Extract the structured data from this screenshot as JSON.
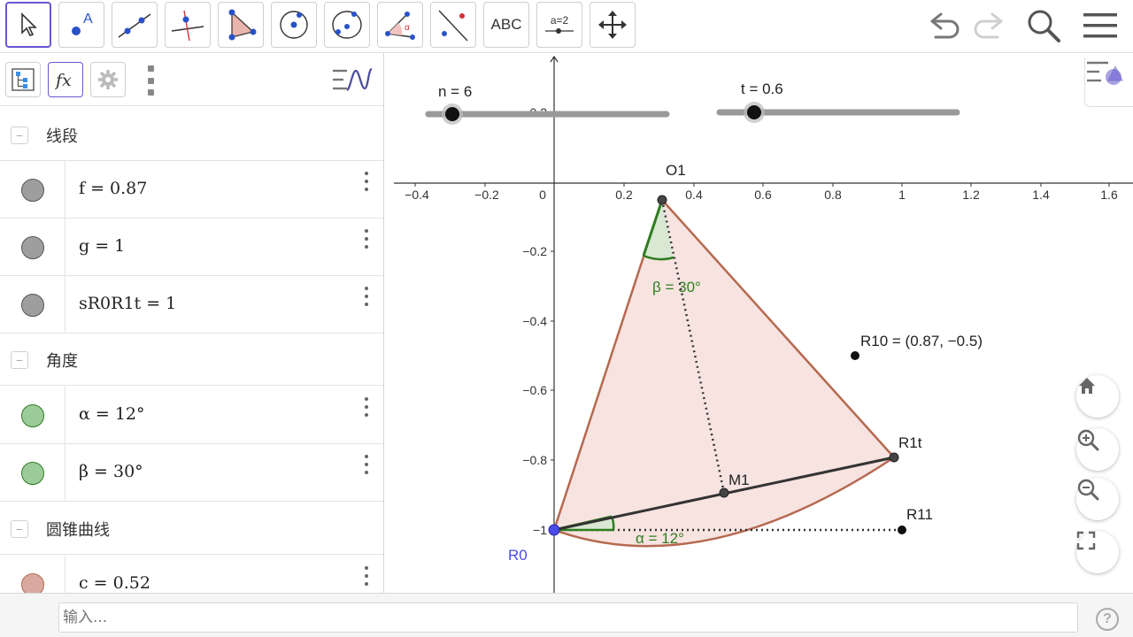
{
  "toolbar": {
    "tools": [
      {
        "id": "move",
        "icon": "arrow-cursor-icon"
      },
      {
        "id": "point",
        "icon": "point-icon"
      },
      {
        "id": "line",
        "icon": "line-icon"
      },
      {
        "id": "perpendicular",
        "icon": "perpendicular-line-icon"
      },
      {
        "id": "polygon",
        "icon": "polygon-icon"
      },
      {
        "id": "circle-center",
        "icon": "circle-center-icon"
      },
      {
        "id": "circle-3-points",
        "icon": "circle-three-points-icon"
      },
      {
        "id": "angle",
        "icon": "angle-icon"
      },
      {
        "id": "reflect",
        "icon": "reflect-icon"
      },
      {
        "id": "text",
        "label": "ABC"
      },
      {
        "id": "slider",
        "label": "a=2"
      },
      {
        "id": "move-view",
        "icon": "move-view-icon"
      }
    ],
    "undo_icon": "undo-icon",
    "redo_icon": "redo-icon",
    "search_icon": "search-icon",
    "menu_icon": "hamburger-menu-icon"
  },
  "algebra": {
    "groups": [
      {
        "label": "线段",
        "items": [
          {
            "expr": "f = 0.87",
            "color": "#9e9e9e"
          },
          {
            "expr": "g = 1",
            "color": "#9e9e9e"
          },
          {
            "expr": "sR0R1t = 1",
            "color": "#9e9e9e"
          }
        ]
      },
      {
        "label": "角度",
        "items": [
          {
            "expr": "α = 12°",
            "color": "#9ccb9a"
          },
          {
            "expr": "β = 30°",
            "color": "#9ccb9a"
          }
        ]
      },
      {
        "label": "圆锥曲线",
        "items": [
          {
            "expr": "c = 0.52",
            "color": "#d9a9a0"
          }
        ]
      }
    ]
  },
  "graphics": {
    "sliders": [
      {
        "label": "n = 6",
        "value": 6
      },
      {
        "label": "t = 0.6",
        "value": 0.6
      }
    ],
    "x_ticks": [
      "−0.4",
      "−0.2",
      "0",
      "0.2",
      "0.4",
      "0.6",
      "0.8",
      "1",
      "1.2",
      "1.4",
      "1.6"
    ],
    "y_ticks": [
      "0.2",
      "−0.2",
      "−0.4",
      "−0.6",
      "−0.8",
      "−1"
    ],
    "labels": {
      "O1": "O1",
      "R10": "R10 = (0.87, −0.5)",
      "R1t": "R1t",
      "M1": "M1",
      "R11": "R11",
      "R0": "R0",
      "beta": "β = 30°",
      "alpha": "α = 12°"
    },
    "buttons": {
      "home_icon": "home-icon",
      "zoom_in_icon": "zoom-in-icon",
      "zoom_out_icon": "zoom-out-icon",
      "fullscreen_icon": "fullscreen-icon",
      "style_bar_icon": "style-bar-icon"
    }
  },
  "input": {
    "placeholder": "输入..."
  },
  "colors": {
    "accent": "#6557d2",
    "sector_fill": "#f7e3e0",
    "sector_stroke": "#b5694f",
    "angle_green": "#2e7d1f",
    "point": "#333333",
    "r0_point": "#4a4ae8"
  }
}
